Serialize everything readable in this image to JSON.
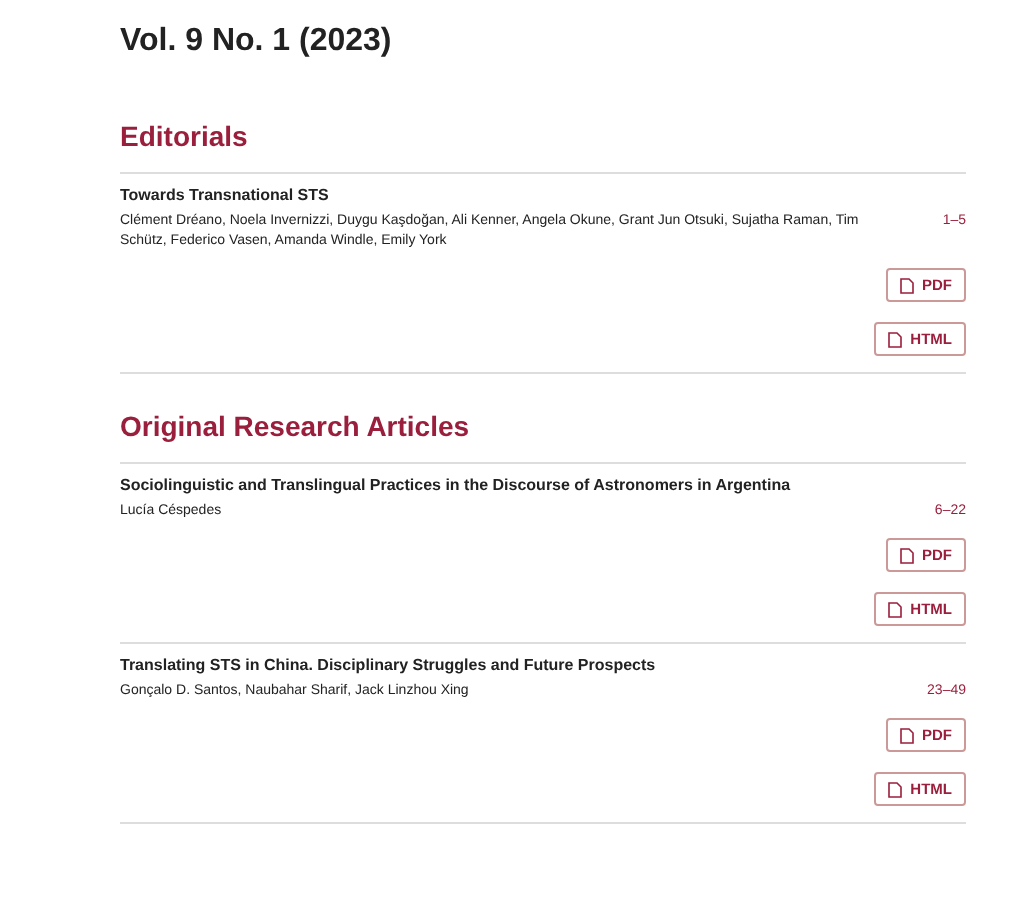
{
  "issue_title": "Vol. 9 No. 1 (2023)",
  "sections": [
    {
      "heading": "Editorials",
      "articles": [
        {
          "title": "Towards Transnational STS",
          "authors": "Clément Dréano, Noela Invernizzi, Duygu Kaşdoğan, Ali Kenner, Angela Okune, Grant Jun Otsuki, Sujatha Raman, Tim Schütz, Federico Vasen, Amanda Windle, Emily York",
          "pages": "1–5",
          "galleys": [
            "PDF",
            "HTML"
          ]
        }
      ]
    },
    {
      "heading": "Original Research Articles",
      "articles": [
        {
          "title": "Sociolinguistic and Translingual Practices in the Discourse of Astronomers in Argentina",
          "authors": "Lucía Céspedes",
          "pages": "6–22",
          "galleys": [
            "PDF",
            "HTML"
          ]
        },
        {
          "title": "Translating STS in China. Disciplinary Struggles and Future Prospects",
          "authors": "Gonçalo D. Santos, Naubahar Sharif, Jack Linzhou Xing",
          "pages": "23–49",
          "galleys": [
            "PDF",
            "HTML"
          ]
        }
      ]
    }
  ]
}
